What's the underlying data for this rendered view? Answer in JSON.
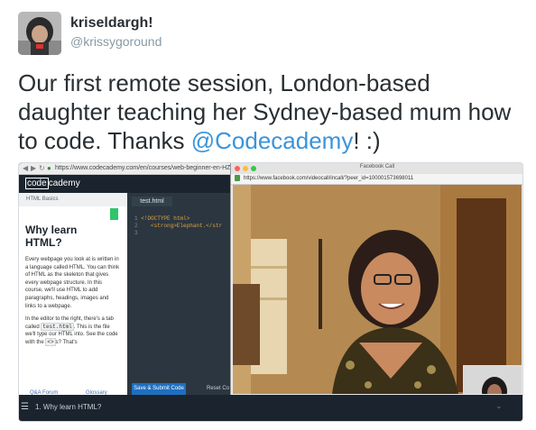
{
  "tweet": {
    "display_name": "kriseldargh!",
    "handle": "@krissygoround",
    "text_before": "Our first remote session, London-based daughter teaching her Sydney-based mum how to code. Thanks ",
    "mention": "@Codecademy",
    "text_after": "! :)"
  },
  "browser": {
    "url": "https://www.codecademy.com/en/courses/web-beginner-en-HZ",
    "nav_icons": [
      "back-icon",
      "forward-icon",
      "reload-icon",
      "lock-icon"
    ]
  },
  "codecademy": {
    "logo_boxed": "code",
    "logo_rest": "cademy",
    "lesson_tab": "HTML Basics",
    "lesson_title": "Why learn HTML?",
    "paragraph1": "Every webpage you look at is written in a language called HTML. You can think of HTML as the skeleton that gives every webpage structure. In this course, we'll use HTML to add paragraphs, headings, images and links to a webpage.",
    "p2_a": "In the editor to the right, there's a tab called ",
    "p2_chip1": "test.html",
    "p2_b": ". This is the file we'll type our HTML into. See the code with the ",
    "p2_chip2": "<>",
    "p2_c": "s? That's",
    "link_forum": "Q&A Forum",
    "link_glossary": "Glossary",
    "editor_tab": "test.html",
    "code_line1_num": "1",
    "code_line1": "<!DOCTYPE html>",
    "code_line2_num": "2",
    "code_line2": "<strong>Elephant.</str",
    "code_line3_num": "3",
    "submit_button": "Save & Submit Code",
    "reset_button": "Reset Co",
    "bottom_menu_icon": "menu-icon",
    "bottom_label": "1. Why learn HTML?"
  },
  "facebook_call": {
    "window_title": "Facebook Call",
    "url": "https://www.facebook.com/videocall/incall/?peer_id=100001573698011",
    "window_dots": [
      "#fc605c",
      "#fdbc40",
      "#34c84a"
    ]
  },
  "colors": {
    "mention": "#3b94d9",
    "codecademy_dark": "#1b242e",
    "submit_blue": "#1f6fbf",
    "bookmark_green": "#2fc56b"
  }
}
